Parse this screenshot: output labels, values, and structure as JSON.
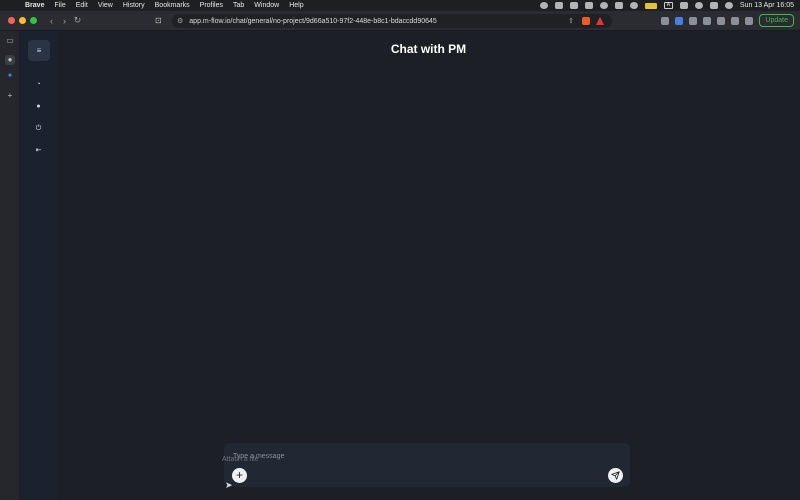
{
  "menubar": {
    "app_name": "Brave",
    "items": [
      "File",
      "Edit",
      "View",
      "History",
      "Bookmarks",
      "Profiles",
      "Tab",
      "Window",
      "Help"
    ],
    "input_source": "A",
    "clock": "Sun 13 Apr  16:05"
  },
  "browser": {
    "url": "app.m-flow.io/chat/general/no-project/9d66a510-97f2-448e-b8c1-bdaccdd90645",
    "update_label": "Update",
    "update_color": "#3fb950"
  },
  "app": {
    "title": "Chat with PM",
    "sidebar_icons": [
      "menu-icon",
      "dashboard-icon",
      "chat-icon",
      "plug-icon",
      "logout-icon"
    ]
  },
  "composer": {
    "placeholder": "Type a message",
    "value": "",
    "attach_tooltip": "Attach a file"
  }
}
